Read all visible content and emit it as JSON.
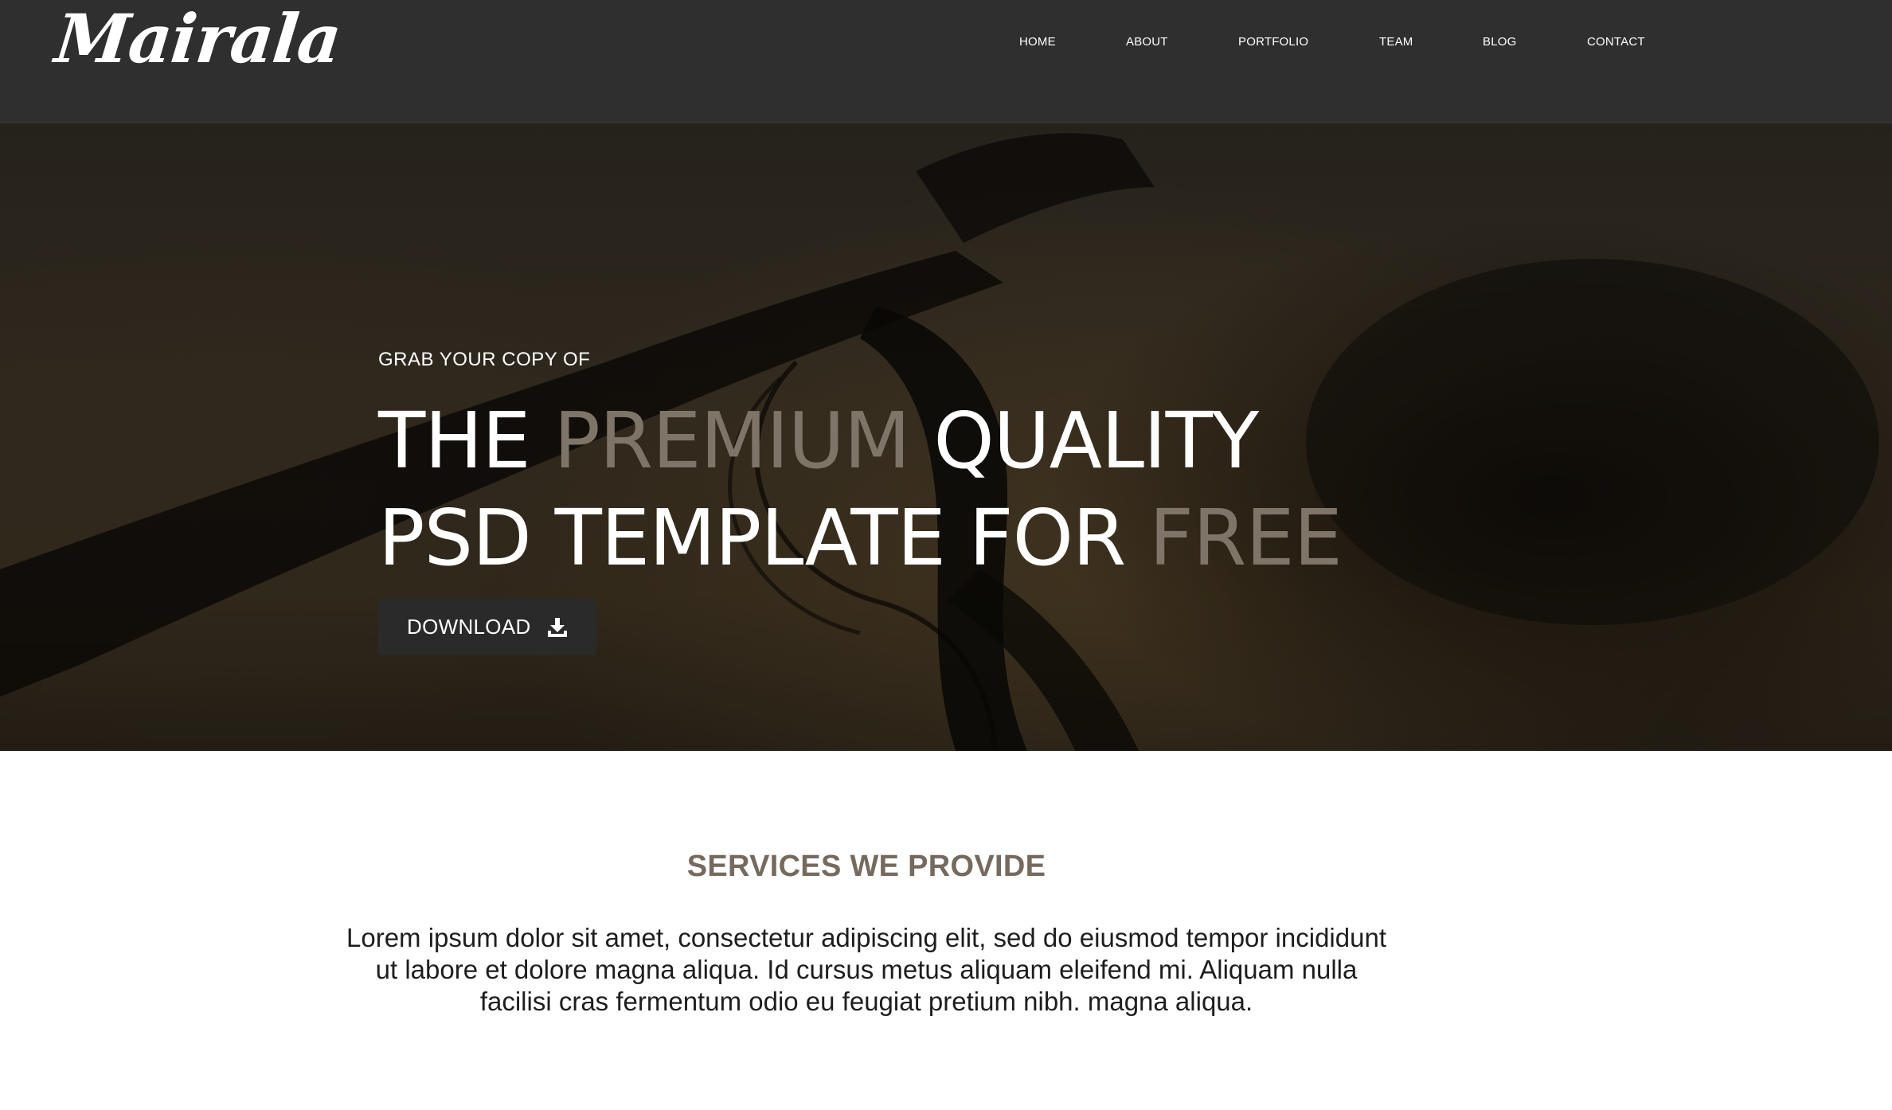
{
  "header": {
    "logo": "Mairala",
    "nav": [
      {
        "label": "HOME"
      },
      {
        "label": "ABOUT"
      },
      {
        "label": "PORTFOLIO"
      },
      {
        "label": "TEAM"
      },
      {
        "label": "BLOG"
      },
      {
        "label": "CONTACT"
      }
    ]
  },
  "hero": {
    "pre_title": "GRAB YOUR COPY OF",
    "line1": {
      "a": "THE ",
      "accent": "PREMIUM",
      "b": " QUALITY"
    },
    "line2": {
      "a": "PSD TEMPLATE FOR ",
      "accent": "FREE"
    },
    "download_label": "DOWNLOAD",
    "download_icon": "download-icon",
    "accent_color": "#7f7468"
  },
  "services": {
    "title": "SERVICES WE PROVIDE",
    "body": "Lorem ipsum dolor sit amet, consectetur adipiscing elit, sed do eiusmod tempor incididunt ut labore et dolore magna aliqua. Id cursus metus aliquam eleifend mi. Aliquam nulla facilisi cras fermentum odio eu feugiat pretium nibh. magna aliqua.",
    "title_color": "#766a5f"
  }
}
